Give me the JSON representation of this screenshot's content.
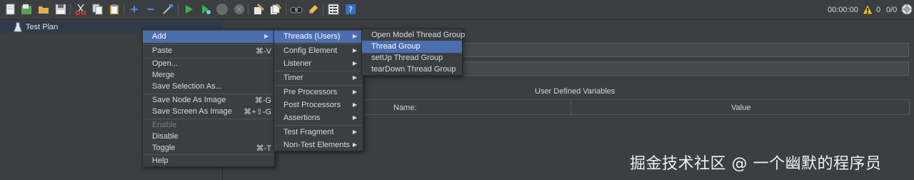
{
  "toolbar": {
    "icons": [
      "new-icon",
      "templates-icon",
      "open-icon",
      "save-icon",
      "cut-icon",
      "copy-icon",
      "paste-icon",
      "expand-icon",
      "collapse-icon",
      "toggle-icon",
      "start-icon",
      "start-no-pause-icon",
      "stop-icon",
      "shutdown-icon",
      "clear-icon",
      "clear-all-icon",
      "search-icon",
      "reset-search-icon",
      "function-helper-icon",
      "help-icon"
    ],
    "elapsed_time": "00:00:00",
    "warning_count": "0",
    "thread_count": "0/0"
  },
  "tree": {
    "selected_label": "Test Plan"
  },
  "panel": {
    "udv_title": "User Defined Variables",
    "columns": [
      "Name:",
      "Value"
    ]
  },
  "context_menu": {
    "items": [
      {
        "label": "Add",
        "shortcut": "",
        "submenu": true
      },
      {
        "label": "Paste",
        "shortcut": "⌘-V"
      },
      {
        "label": "Open...",
        "shortcut": ""
      },
      {
        "label": "Merge",
        "shortcut": ""
      },
      {
        "label": "Save Selection As...",
        "shortcut": ""
      },
      {
        "label": "Save Node As Image",
        "shortcut": "⌘-G"
      },
      {
        "label": "Save Screen As Image",
        "shortcut": "⌘+⇧-G"
      },
      {
        "label": "Enable",
        "shortcut": ""
      },
      {
        "label": "Disable",
        "shortcut": ""
      },
      {
        "label": "Toggle",
        "shortcut": "⌘-T"
      },
      {
        "label": "Help",
        "shortcut": ""
      }
    ]
  },
  "add_menu": {
    "items": [
      "Threads (Users)",
      "Config Element",
      "Listener",
      "Timer",
      "Pre Processors",
      "Post Processors",
      "Assertions",
      "Test Fragment",
      "Non-Test Elements"
    ]
  },
  "threads_menu": {
    "items": [
      "Open Model Thread Group",
      "Thread Group",
      "setUp Thread Group",
      "tearDown Thread Group"
    ]
  },
  "watermark": "掘金技术社区 @ 一个幽默的程序员",
  "colors": {
    "background": "#3c3f41",
    "selection": "#4b6eaf",
    "tree_selection": "#2f3a4b"
  }
}
